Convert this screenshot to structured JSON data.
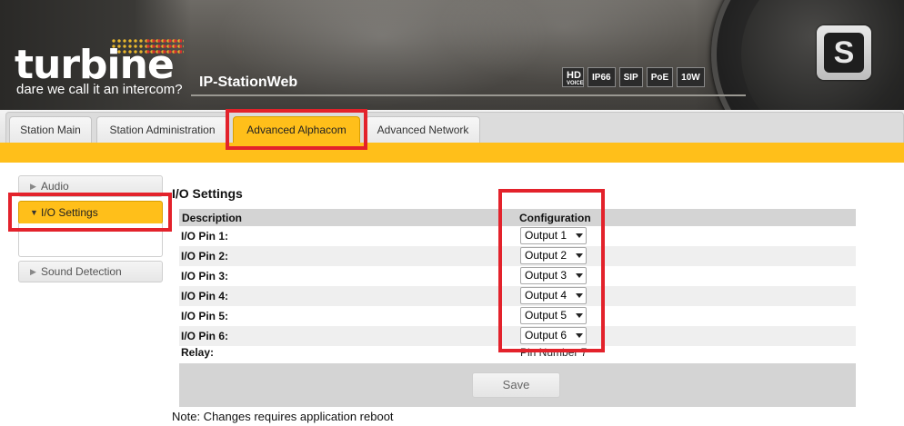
{
  "header": {
    "logo_text": "turbine",
    "tagline": "dare we call it an intercom?",
    "product_name": "IP-StationWeb",
    "badges": [
      {
        "label": "HD",
        "sub": "VOICE"
      },
      {
        "label": "IP66"
      },
      {
        "label": "SIP"
      },
      {
        "label": "PoE"
      },
      {
        "label": "10W"
      }
    ],
    "emblem_icon": "stentofon-s-icon"
  },
  "tabs": [
    {
      "label": "Station Main",
      "active": false
    },
    {
      "label": "Station Administration",
      "active": false
    },
    {
      "label": "Advanced Alphacom",
      "active": true
    },
    {
      "label": "Advanced Network",
      "active": false
    }
  ],
  "sidebar": {
    "items": [
      {
        "label": "Audio",
        "active": false
      },
      {
        "label": "I/O Settings",
        "active": true
      },
      {
        "label": "Sound Detection",
        "active": false
      }
    ]
  },
  "main": {
    "title": "I/O Settings",
    "table": {
      "headers": [
        "Description",
        "Configuration"
      ],
      "rows": [
        {
          "label": "I/O Pin 1:",
          "value": "Output 1"
        },
        {
          "label": "I/O Pin 2:",
          "value": "Output 2"
        },
        {
          "label": "I/O Pin 3:",
          "value": "Output 3"
        },
        {
          "label": "I/O Pin 4:",
          "value": "Output 4"
        },
        {
          "label": "I/O Pin 5:",
          "value": "Output 5"
        },
        {
          "label": "I/O Pin 6:",
          "value": "Output 6"
        }
      ],
      "relay": {
        "label": "Relay:",
        "value": "Pin Number 7"
      }
    },
    "save_label": "Save",
    "note": "Note: Changes requires application reboot"
  },
  "colors": {
    "accent": "#ffbf1a",
    "annotation": "#e3222b"
  }
}
